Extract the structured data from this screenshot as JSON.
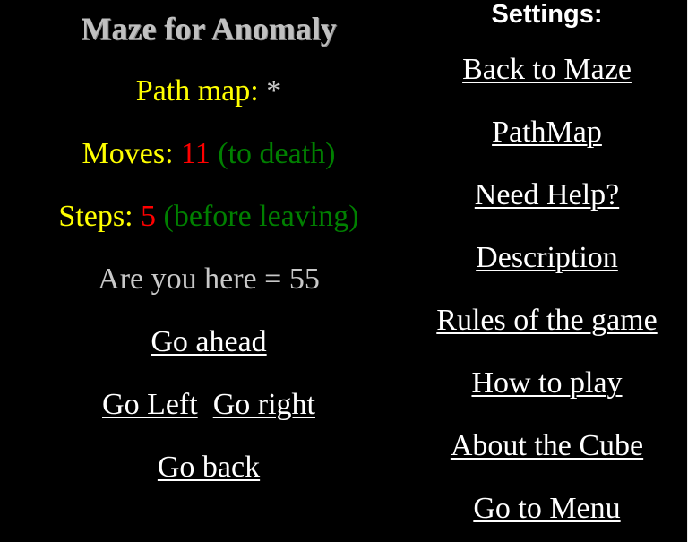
{
  "game": {
    "title": "Maze for Anomaly",
    "path_map_label": "Path map:",
    "path_map_value": "*",
    "moves_label": "Moves:",
    "moves_value": "11",
    "moves_note": "(to death)",
    "steps_label": "Steps:",
    "steps_value": "5",
    "steps_note": "(before leaving)",
    "location_text": "Are you here = 55"
  },
  "navigation": {
    "ahead": "Go ahead",
    "left": "Go Left",
    "right": "Go right",
    "back": "Go back"
  },
  "settings": {
    "heading": "Settings:",
    "links": [
      "Back to Maze",
      "PathMap",
      "Need Help?",
      "Description",
      "Rules of the game",
      "How to play",
      "About the Cube",
      "Go to Menu"
    ]
  },
  "colors": {
    "label": "#ffff00",
    "value": "#ff0000",
    "note": "#008000",
    "title": "#c0c0c0",
    "link": "#ffffff",
    "background": "#000000"
  }
}
